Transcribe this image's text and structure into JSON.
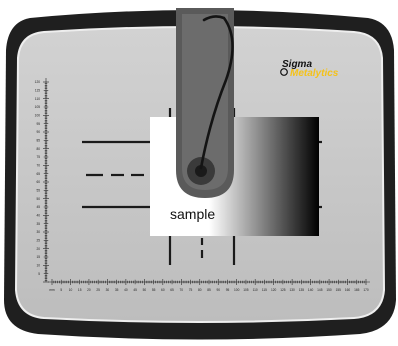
{
  "brand": {
    "line1": "Sigma",
    "line2": "Metalytics"
  },
  "sample_label": "sample",
  "x_axis": {
    "unit": "mm",
    "min": 0,
    "max": 170,
    "label_step": 5
  },
  "y_axis": {
    "min": 0,
    "max": 120,
    "label_step": 5
  },
  "colors": {
    "frame": "#1f1f1f",
    "plate": "#c9c9c9",
    "arm": "#5a5a5a",
    "arm_dark": "#3c3c3c",
    "cable": "#1a1a1a",
    "brand_accent": "#f4c21a",
    "gradient_start": "#ffffff",
    "gradient_end": "#000000"
  },
  "icons": {
    "probe": "eddy-current-probe-icon",
    "logo": "sigma-metalytics-logo"
  }
}
